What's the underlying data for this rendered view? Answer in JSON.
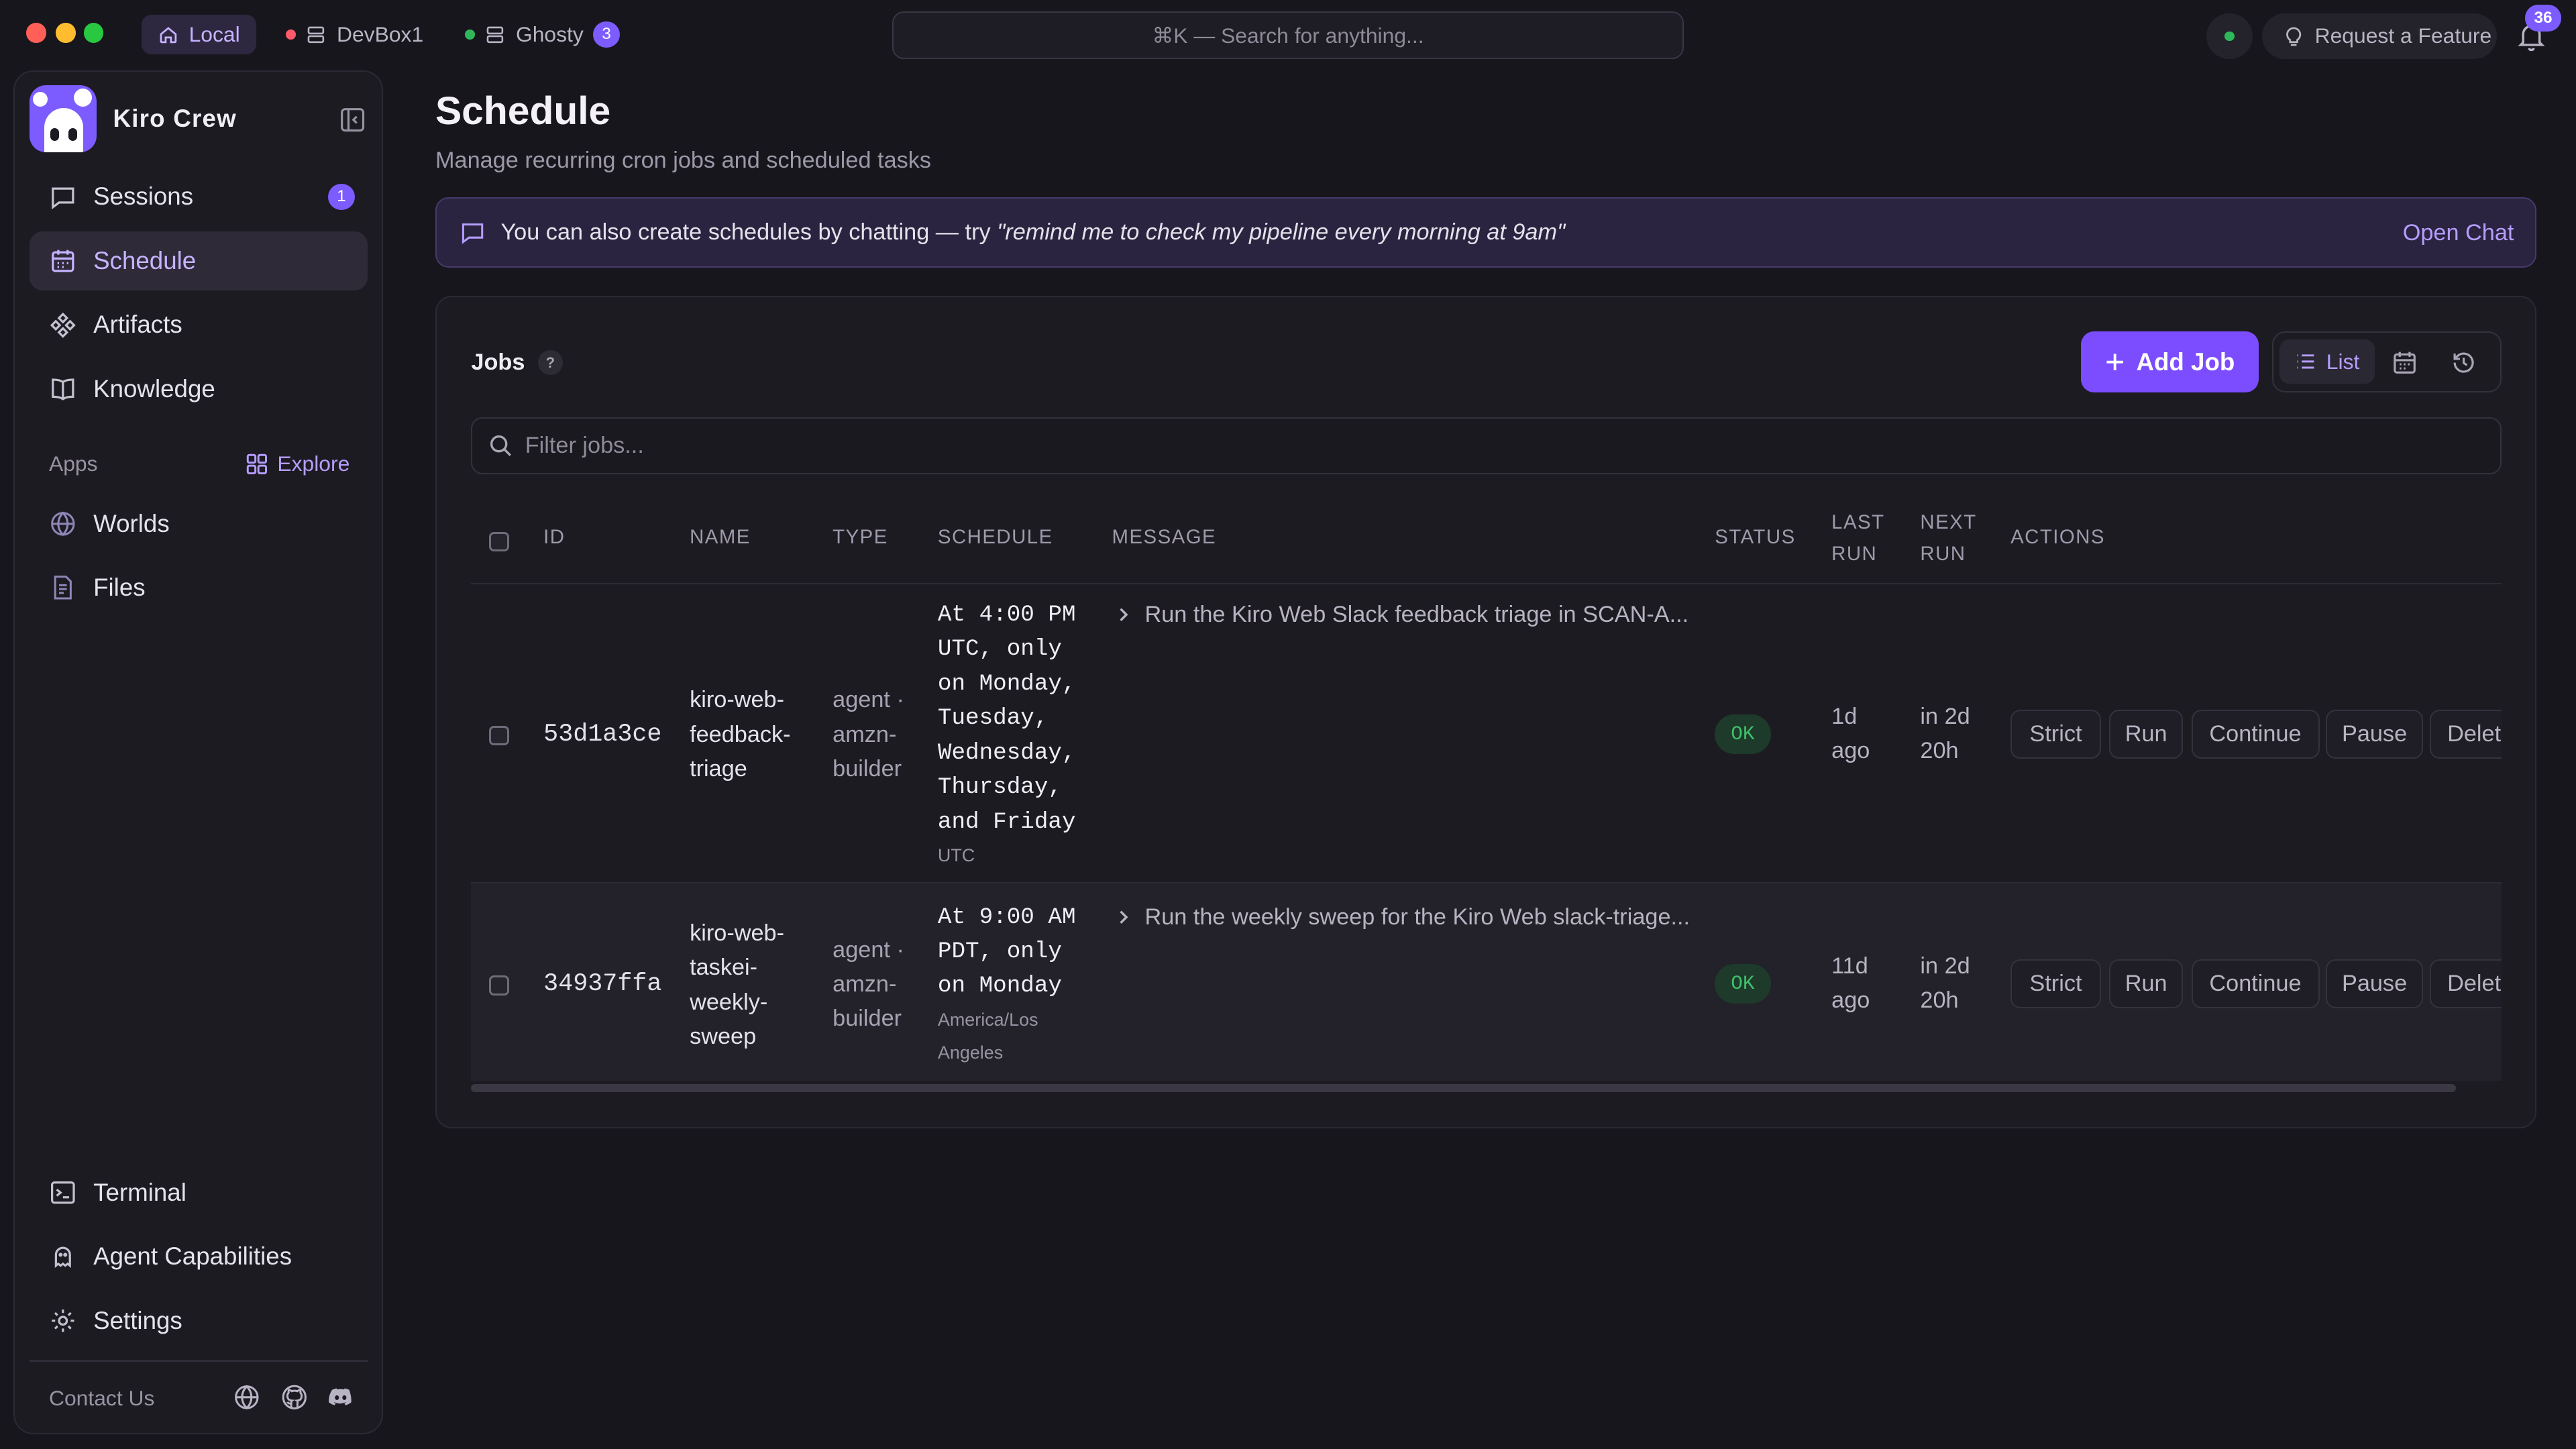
{
  "titlebar": {
    "tabs": [
      {
        "label": "Local"
      },
      {
        "label": "DevBox1"
      },
      {
        "label": "Ghosty",
        "badge": "3"
      }
    ],
    "search_placeholder": "⌘K — Search for anything...",
    "request_feature": "Request a Feature",
    "notifications_count": "36"
  },
  "sidebar": {
    "brand": "Kiro Crew",
    "nav": [
      {
        "label": "Sessions",
        "badge": "1"
      },
      {
        "label": "Schedule"
      },
      {
        "label": "Artifacts"
      },
      {
        "label": "Knowledge"
      }
    ],
    "apps_label": "Apps",
    "explore_label": "Explore",
    "apps": [
      {
        "label": "Worlds"
      },
      {
        "label": "Files"
      }
    ],
    "bottom": [
      {
        "label": "Terminal"
      },
      {
        "label": "Agent Capabilities"
      },
      {
        "label": "Settings"
      }
    ],
    "contact": "Contact Us"
  },
  "main": {
    "title": "Schedule",
    "subtitle": "Manage recurring cron jobs and scheduled tasks",
    "banner": {
      "text": "You can also create schedules by chatting — try ",
      "quote": "\"remind me to check my pipeline every morning at 9am\"",
      "action": "Open Chat"
    },
    "jobs": {
      "label": "Jobs",
      "help": "?",
      "add_button": "Add Job",
      "view_list": "List",
      "filter_placeholder": "Filter jobs...",
      "headers": {
        "id": "ID",
        "name": "NAME",
        "type": "TYPE",
        "schedule": "SCHEDULE",
        "message": "MESSAGE",
        "status": "STATUS",
        "last_run_1": "LAST",
        "last_run_2": "RUN",
        "next_run_1": "NEXT",
        "next_run_2": "RUN",
        "actions": "ACTIONS"
      },
      "rows": [
        {
          "id": "53d1a3ce",
          "name": [
            "kiro-web-",
            "feedback-",
            "triage"
          ],
          "type": [
            "agent ·",
            "amzn-",
            "builder"
          ],
          "schedule": [
            "At 4:00 PM",
            "UTC, only",
            "on Monday,",
            "Tuesday,",
            "Wednesday,",
            "Thursday,",
            "and Friday"
          ],
          "tz": [
            "UTC"
          ],
          "message": "Run the Kiro Web Slack feedback triage in SCAN-A...",
          "status": "OK",
          "last_run": [
            "1d",
            "ago"
          ],
          "next_run": [
            "in 2d",
            "20h"
          ],
          "actions": [
            "Strict",
            "Run",
            "Continue",
            "Pause",
            "Delete"
          ]
        },
        {
          "id": "34937ffa",
          "name": [
            "kiro-web-",
            "taskei-",
            "weekly-",
            "sweep"
          ],
          "type": [
            "agent ·",
            "amzn-",
            "builder"
          ],
          "schedule": [
            "At 9:00 AM",
            "PDT, only",
            "on Monday"
          ],
          "tz": [
            "America/Los",
            "Angeles"
          ],
          "message": "Run the weekly sweep for the Kiro Web slack-triage...",
          "status": "OK",
          "last_run": [
            "11d",
            "ago"
          ],
          "next_run": [
            "in 2d",
            "20h"
          ],
          "actions": [
            "Strict",
            "Run",
            "Continue",
            "Pause",
            "Delete"
          ]
        }
      ]
    }
  },
  "colors": {
    "accent": "#7c4dff",
    "accent_text": "#b59dff",
    "background": "#18161d",
    "status_ok": "#3fbf6a"
  }
}
